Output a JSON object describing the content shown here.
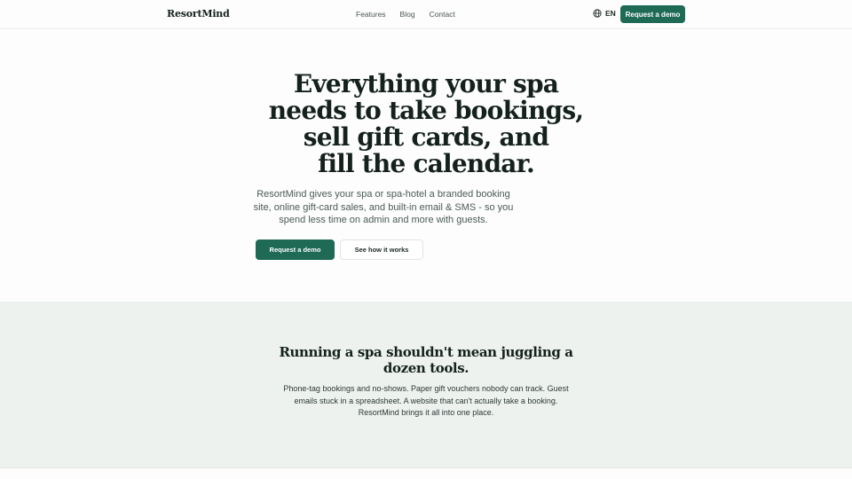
{
  "header": {
    "logo": "ResortMind",
    "nav": [
      "Features",
      "Blog",
      "Contact"
    ],
    "language": "EN",
    "cta": "Request a demo"
  },
  "hero": {
    "title_lines": [
      "Everything your spa",
      "needs to take bookings,",
      "sell gift cards, and",
      "fill the calendar."
    ],
    "subtitle": "ResortMind gives your spa or spa-hotel a branded booking site, online gift-card sales, and built-in email & SMS - so you spend less time on admin and more with guests.",
    "primary_cta": "Request a demo",
    "secondary_cta": "See how it works"
  },
  "problem": {
    "title": "Running a spa shouldn't mean juggling a dozen tools.",
    "text": "Phone-tag bookings and no-shows. Paper gift vouchers nobody can track. Guest emails stuck in a spreadsheet. A website that can't actually take a booking. ResortMind brings it all into one place."
  },
  "colors": {
    "accent": "#1e6a55",
    "section_bg": "#eef2ef",
    "heading": "#14211c"
  }
}
